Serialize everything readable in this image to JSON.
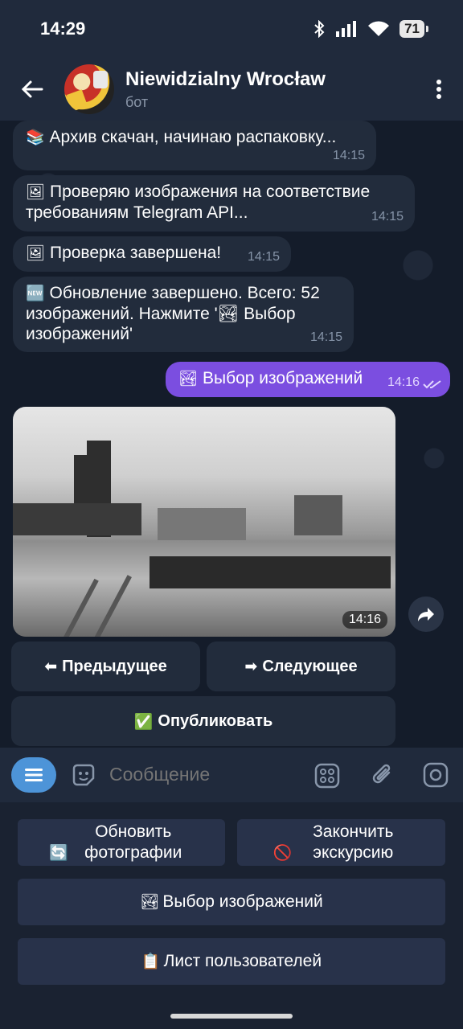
{
  "status": {
    "time": "14:29",
    "battery": "71"
  },
  "header": {
    "title": "Niewidzialny Wrocław",
    "subtitle": "бот"
  },
  "messages": [
    {
      "emoji": "📚",
      "text": "Архив скачан, начинаю распаковку...",
      "time": "14:15"
    },
    {
      "emoji": "🖼",
      "text": "Проверяю изображения на соответствие требованиям Telegram API...",
      "time": "14:15"
    },
    {
      "emoji": "🖼",
      "text": "Проверка завершена!",
      "time": "14:15"
    },
    {
      "emoji": "🆕",
      "text": "Обновление завершено. Всего: 52 изображений. Нажмите '🏞 Выбор изображений'",
      "time": "14:15"
    }
  ],
  "outgoing": {
    "emoji": "🏞",
    "text": "Выбор изображений",
    "time": "14:16"
  },
  "photo": {
    "time": "14:16"
  },
  "inline_buttons": {
    "prev": {
      "emoji": "⬅",
      "label": "Предыдущее"
    },
    "next": {
      "emoji": "➡",
      "label": "Следующее"
    },
    "publish": {
      "emoji": "✅",
      "label": "Опубликовать"
    }
  },
  "input": {
    "placeholder": "Сообщение"
  },
  "keyboard": {
    "refresh": {
      "emoji": "🔄",
      "label": "Обновить фотографии"
    },
    "finish": {
      "emoji": "🚫",
      "label": "Закончить экскурсию"
    },
    "select": {
      "emoji": "🏞",
      "label": "Выбор изображений"
    },
    "users": {
      "emoji": "📋",
      "label": "Лист пользователей"
    }
  },
  "colors": {
    "accent": "#7b4ee0",
    "menu_button": "#4d94d8",
    "background": "#141c2a"
  }
}
